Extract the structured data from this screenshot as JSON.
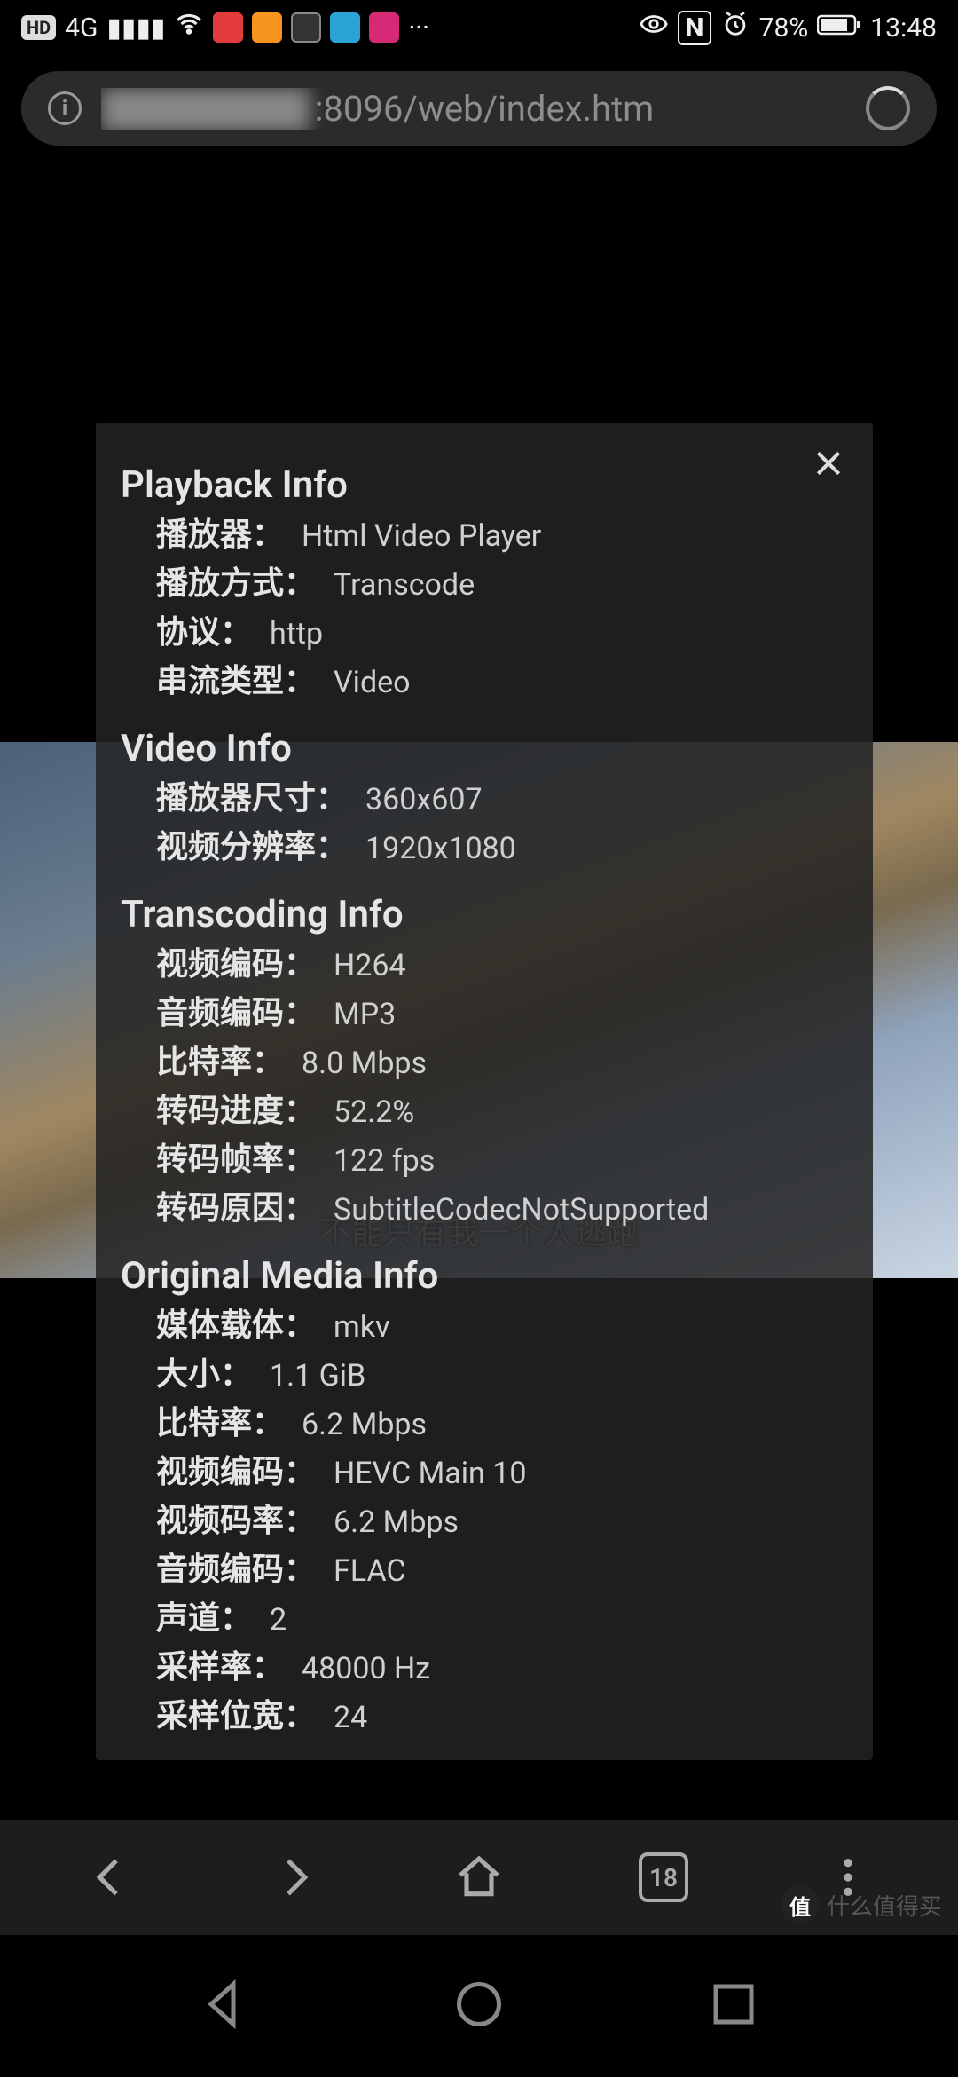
{
  "status": {
    "hd": "HD",
    "net": "4G",
    "dots": "···",
    "nfc": "N",
    "battery": "78%",
    "time": "13:48"
  },
  "address": {
    "url_visible": ":8096/web/index.htm"
  },
  "video": {
    "subtitle": "不能只有我一个人逃跑"
  },
  "panel": {
    "playback": {
      "title": "Playback Info",
      "player_label": "播放器",
      "player_value": "Html Video Player",
      "mode_label": "播放方式",
      "mode_value": "Transcode",
      "protocol_label": "协议",
      "protocol_value": "http",
      "stream_label": "串流类型",
      "stream_value": "Video"
    },
    "videoInfo": {
      "title": "Video Info",
      "player_size_label": "播放器尺寸",
      "player_size_value": "360x607",
      "resolution_label": "视频分辨率",
      "resolution_value": "1920x1080"
    },
    "transcoding": {
      "title": "Transcoding Info",
      "vcodec_label": "视频编码",
      "vcodec_value": "H264",
      "acodec_label": "音频编码",
      "acodec_value": "MP3",
      "bitrate_label": "比特率",
      "bitrate_value": "8.0 Mbps",
      "progress_label": "转码进度",
      "progress_value": "52.2%",
      "fps_label": "转码帧率",
      "fps_value": "122 fps",
      "reason_label": "转码原因",
      "reason_value": "SubtitleCodecNotSupported"
    },
    "original": {
      "title": "Original Media Info",
      "container_label": "媒体载体",
      "container_value": "mkv",
      "size_label": "大小",
      "size_value": "1.1 GiB",
      "bitrate_label": "比特率",
      "bitrate_value": "6.2 Mbps",
      "vcodec_label": "视频编码",
      "vcodec_value": "HEVC Main 10",
      "vbitrate_label": "视频码率",
      "vbitrate_value": "6.2 Mbps",
      "acodec_label": "音频编码",
      "acodec_value": "FLAC",
      "channels_label": "声道",
      "channels_value": "2",
      "sample_label": "采样率",
      "sample_value": "48000 Hz",
      "bitdepth_label": "采样位宽",
      "bitdepth_value": "24"
    }
  },
  "browser": {
    "tabs": "18"
  },
  "watermark": {
    "text": "什么值得买",
    "badge": "值"
  }
}
